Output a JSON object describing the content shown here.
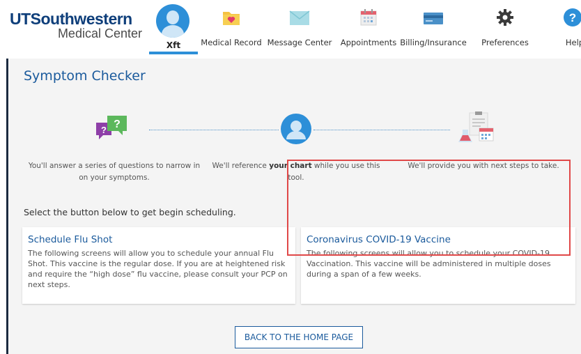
{
  "header": {
    "logo": {
      "line1": "UTSouthwestern",
      "line2": "Medical Center"
    },
    "user": {
      "label": "Xft"
    },
    "nav": [
      {
        "label": "Medical Record",
        "icon": "medical-record-icon"
      },
      {
        "label": "Message Center",
        "icon": "envelope-icon"
      },
      {
        "label": "Appointments",
        "icon": "calendar-icon"
      },
      {
        "label": "Billing/Insurance",
        "icon": "credit-card-icon"
      },
      {
        "label": "Preferences",
        "icon": "gear-icon"
      },
      {
        "label": "Help",
        "icon": "help-icon"
      }
    ]
  },
  "main": {
    "title": "Symptom Checker",
    "steps": [
      {
        "icon": "question-bubbles-icon",
        "text": "You'll answer a series of questions to narrow in on your symptoms."
      },
      {
        "icon": "user-avatar-icon",
        "text_before": "We'll reference ",
        "text_bold": "your chart",
        "text_after": " while you use this tool."
      },
      {
        "icon": "clipboard-calendar-icon",
        "text": "We'll provide you with next steps to take."
      }
    ],
    "select_prompt": "Select the button below to get begin scheduling.",
    "cards": [
      {
        "title": "Schedule Flu Shot",
        "description": "The following screens will allow you to schedule your annual Flu Shot. This vaccine is the regular dose. If you are at heightened risk and require the “high dose” flu vaccine, please consult your PCP on next steps."
      },
      {
        "title": "Coronavirus COVID-19 Vaccine",
        "description": "The following screens will allow you to schedule your COVID-19 Vaccination. This vaccine will be administered in multiple doses during a span of a few weeks."
      }
    ],
    "back_button": "BACK TO THE HOME PAGE"
  },
  "colors": {
    "brand_blue": "#0e3e7a",
    "link_blue": "#1a5a9c",
    "accent_blue": "#2d8fd8",
    "highlight_red": "#e04848",
    "panel_bg": "#f4f4f4"
  }
}
